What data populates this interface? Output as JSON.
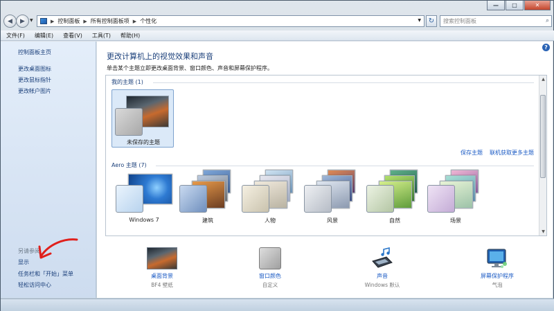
{
  "window": {
    "controls": [
      "—",
      "□",
      "✕"
    ]
  },
  "address": {
    "crumbs": [
      "控制面板",
      "所有控制面板项",
      "个性化"
    ],
    "search_placeholder": "搜索控制面板"
  },
  "menu": [
    "文件(F)",
    "编辑(E)",
    "查看(V)",
    "工具(T)",
    "帮助(H)"
  ],
  "left_pane": {
    "home": "控制面板主页",
    "tasks": [
      "更改桌面图标",
      "更改鼠标指针",
      "更改帐户图片"
    ],
    "see_also_heading": "另请参阅",
    "see_also": [
      "显示",
      "任务栏和「开始」菜单",
      "轻松访问中心"
    ]
  },
  "main": {
    "help_icon": "?",
    "title": "更改计算机上的视觉效果和声音",
    "subtitle": "单击某个主题立即更改桌面背景、窗口颜色、声音和屏幕保护程序。",
    "my_themes_label": "我的主题 (1)",
    "my_theme_name": "未保存的主题",
    "save_theme": "保存主题",
    "get_more_online": "联机获取更多主题",
    "aero_label": "Aero 主题 (7)",
    "aero_themes": [
      "Windows 7",
      "建筑",
      "人物",
      "风景",
      "自然",
      "场景"
    ]
  },
  "bottom": [
    {
      "label": "桌面背景",
      "sub": "BF4 壁纸"
    },
    {
      "label": "窗口颜色",
      "sub": "自定义"
    },
    {
      "label": "声音",
      "sub": "Windows 默认"
    },
    {
      "label": "屏幕保护程序",
      "sub": "气泡"
    }
  ],
  "colors": {
    "link": "#1a5ac4",
    "arrow": "#e0201c",
    "selected_tile": "#dbe9f8"
  },
  "icons": {
    "help": "help-icon",
    "refresh": "refresh-icon",
    "search": "search-icon",
    "back": "back-arrow-icon",
    "forward": "forward-arrow-icon"
  }
}
